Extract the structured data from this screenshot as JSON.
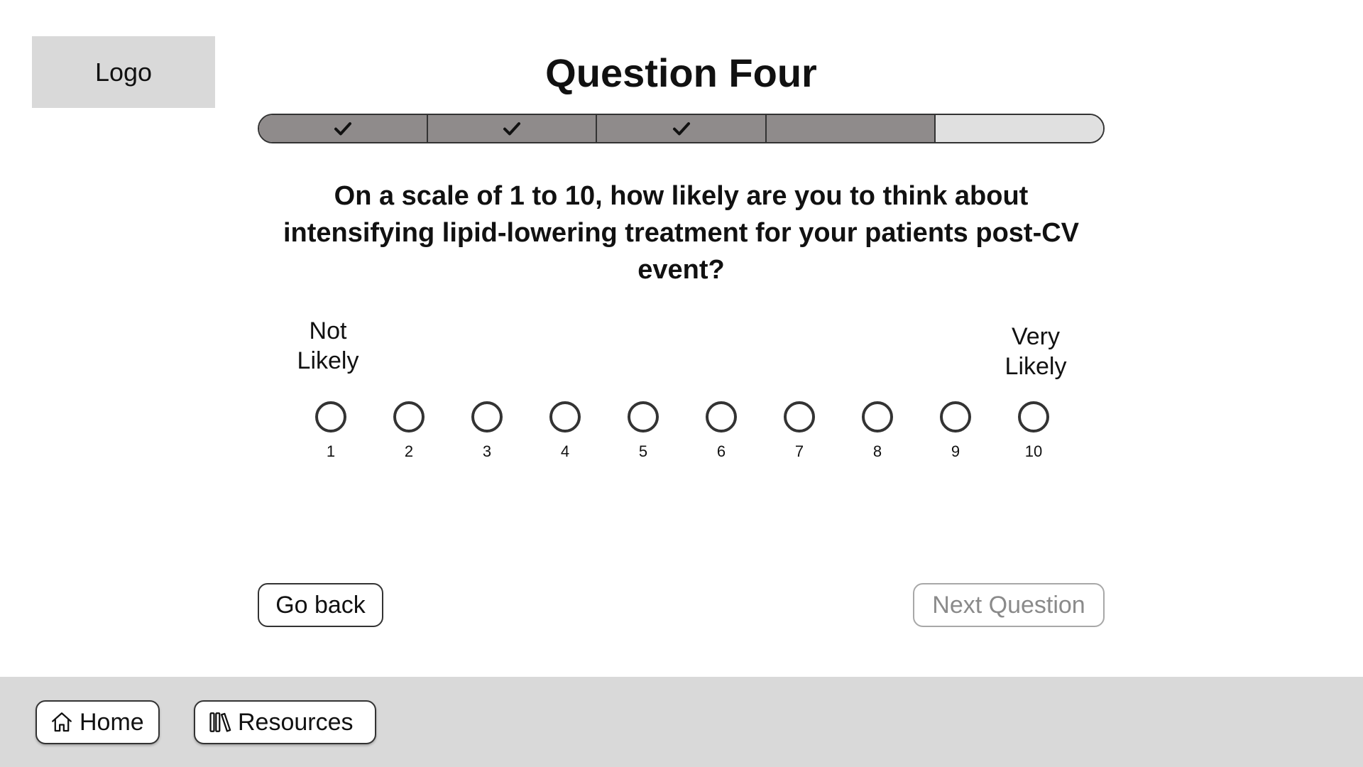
{
  "logo": {
    "label": "Logo"
  },
  "header": {
    "title": "Question Four"
  },
  "progress": {
    "total_steps": 5,
    "completed_steps": 3,
    "current_step": 4,
    "steps": [
      {
        "status": "completed",
        "icon": "check-icon"
      },
      {
        "status": "completed",
        "icon": "check-icon"
      },
      {
        "status": "completed",
        "icon": "check-icon"
      },
      {
        "status": "current"
      },
      {
        "status": "upcoming"
      }
    ]
  },
  "question": {
    "text": "On a scale of 1 to 10, how likely are you to think about intensifying lipid-lowering treatment for your patients post-CV event?"
  },
  "scale": {
    "low_label_line1": "Not",
    "low_label_line2": "Likely",
    "high_label_line1": "Very",
    "high_label_line2": "Likely",
    "options": [
      "1",
      "2",
      "3",
      "4",
      "5",
      "6",
      "7",
      "8",
      "9",
      "10"
    ],
    "selected": null
  },
  "actions": {
    "back_label": "Go back",
    "next_label": "Next Question",
    "next_disabled": true
  },
  "footer": {
    "home_label": "Home",
    "home_icon": "home-icon",
    "resources_label": "Resources",
    "resources_icon": "books-icon"
  },
  "colors": {
    "progress_done": "#8f8b8b",
    "progress_pending": "#e0e0e0",
    "footer_bg": "#d9d9d9",
    "logo_bg": "#d9d9d9",
    "disabled_text": "#8a8a8a"
  }
}
